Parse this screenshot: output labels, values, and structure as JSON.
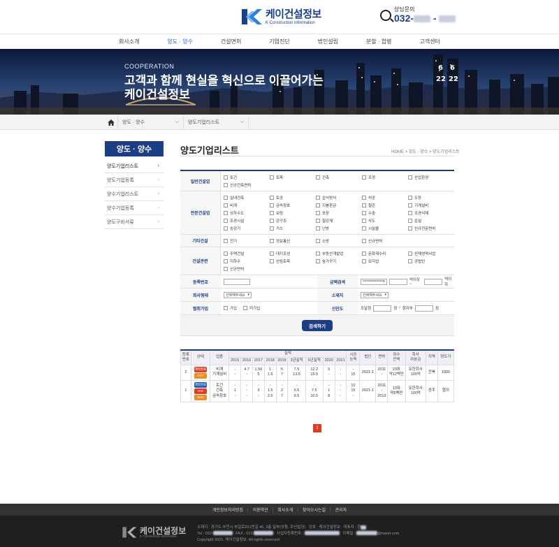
{
  "header": {
    "logo_main": "케이건설정보",
    "logo_sub": "K Construction information",
    "consult_label": "상담문의",
    "consult_prefix": "032-"
  },
  "nav": {
    "items": [
      "회사소개",
      "양도 · 양수",
      "건설면허",
      "기업진단",
      "법인설립",
      "분할 · 합병",
      "고객센터"
    ],
    "active_index": 1
  },
  "banner": {
    "tag": "COOPERATION",
    "title_line1": "고객과 함께 현실을 혁신으로 이끌어가는",
    "title_line2": "케이건설정보"
  },
  "breadcrumb": {
    "select1": "양도 · 양수",
    "select2": "양도기업리스트"
  },
  "sidebar": {
    "title": "양도 · 양수",
    "items": [
      "양도기업리스트",
      "양도기업등록",
      "양수기업리스트",
      "양수기업등록",
      "양도구비서류"
    ],
    "active_index": 0
  },
  "content": {
    "title": "양도기업리스트",
    "location": "HOME > 양도 · 양수 > 양도기업리스트"
  },
  "form": {
    "rows": [
      {
        "head": "일반건설업",
        "items": [
          "토건",
          "토목",
          "건축",
          "조경",
          "산업환경",
          "신규건축면허"
        ]
      },
      {
        "head": "전문건설업",
        "items": [
          "실내건축",
          "토공",
          "습식방식",
          "석공",
          "도장",
          "비계",
          "금속창호",
          "지붕판금",
          "철콘",
          "기계설비",
          "상하수도",
          "보링",
          "포장",
          "수중",
          "조경식재",
          "조경시설",
          "강구조",
          "철강재",
          "삭도",
          "준설",
          "승강기",
          "가스",
          "난방",
          "시설물",
          "신규전문면허"
        ]
      },
      {
        "head": "기타건설",
        "items": [
          "전기",
          "정보통신",
          "소방",
          "신규면허"
        ]
      },
      {
        "head": "건설관련",
        "items": [
          "주택건설",
          "대지조성",
          "부동산개발업",
          "문화재수리",
          "산재영역사업",
          "지하수",
          "산림토목",
          "숲가꾸기",
          "묘지업",
          "공법인",
          "신규면허"
        ]
      }
    ],
    "reg_no_label": "등록번호",
    "amount_label": "금액검색",
    "amount_select": "==========",
    "amount_from": "억이상 ~",
    "amount_to": "억이하",
    "company_type_label": "회사형태",
    "company_type_select": "선택해주세요",
    "location_label": "소재지",
    "location_select": "선택해주세요",
    "assoc_label": "협회가입",
    "assoc_yes": "가입",
    "assoc_no": "미가입",
    "credit_label": "신인도",
    "credit_add_label": "조달청",
    "credit_unit": "점",
    "credit_sep": "/",
    "credit_sub_label": "항자부",
    "search_button": "검색하기"
  },
  "table": {
    "headers": [
      "등록\n번호",
      "상태",
      "업종",
      "실적",
      "시공\n능력",
      "법인",
      "면허",
      "좌수\n잔액",
      "회사\n자본금",
      "지역",
      "양도가"
    ],
    "years": [
      "2015",
      "2016",
      "2017",
      "2018",
      "2019",
      "3년실적",
      "5년실적",
      "2020",
      "2021"
    ],
    "rows": [
      {
        "no": "2",
        "badges": [
          {
            "text": "계약완료",
            "color": "red"
          },
          {
            "text": "HOT",
            "color": "orange"
          }
        ],
        "types": [
          "비계",
          "기계설비"
        ],
        "vals": [
          [
            "-",
            "-"
          ],
          [
            "4.7",
            "-"
          ],
          [
            "1.50",
            "5"
          ],
          [
            "1",
            "1.5"
          ],
          [
            "5",
            "7"
          ],
          [
            "7.5",
            "13.5"
          ],
          [
            "12.2",
            "15.5"
          ],
          [
            "6",
            "-"
          ],
          [
            "-",
            "-"
          ]
        ],
        "capacity": [
          "-",
          "15"
        ],
        "corp": "2021-1",
        "license": [
          "2011",
          "-"
        ],
        "balance": [
          "23좌",
          "약12백만"
        ],
        "capital": [
          "유한회사",
          "100억"
        ],
        "region": "전북",
        "price": "1000"
      },
      {
        "no": "1",
        "badges": [
          {
            "text": "계약완료",
            "color": "blue"
          },
          {
            "text": "new",
            "color": "red"
          },
          {
            "text": "Best",
            "color": "orange"
          }
        ],
        "types": [
          "토건",
          "건축",
          "금속창호"
        ],
        "vals": [
          [
            "-",
            "1",
            "-"
          ],
          [
            "-",
            "-",
            "-"
          ],
          [
            "-",
            "3",
            "-"
          ],
          [
            "-",
            "1.5",
            "2.5"
          ],
          [
            "-",
            "2",
            "7"
          ],
          [
            "-",
            "6.5",
            "9.5"
          ],
          [
            "-",
            "7.5",
            "10.5"
          ],
          [
            "-",
            "1",
            "8"
          ],
          [
            "-",
            "-",
            "-"
          ]
        ],
        "capacity": [
          "10",
          "15",
          "-"
        ],
        "corp": "2021-1",
        "license": [
          "2011",
          "-",
          "2013"
        ],
        "balance": [
          "13좌",
          "약5백만"
        ],
        "capital": [
          "유한회사",
          "100억"
        ],
        "region": "광주",
        "price": "협의"
      }
    ],
    "page": "1"
  },
  "footer": {
    "nav": [
      "개인정보처리방침",
      "이용약관",
      "회사소개",
      "찾아오시는길",
      "관리자"
    ],
    "logo_main": "케이건설정보",
    "logo_sub": "K Construction information",
    "line1_address": "소재지 : 경기도 부천시 부일로221번길 46, 2층 일부(상동, 우신빌딩)",
    "line1_company": "상호 : 케이건설정보",
    "line1_ceo": "대표자 : 한",
    "line2_tel": "Tel : 032-",
    "line2_fax": "FAX : 032-",
    "line2_reg": "사업자등록번호 :",
    "line2_email": "이메일 :",
    "line2_email_domain": "@naver.com",
    "copyright": "Copyright 2021. 케이건설정보.  All rights reserved."
  },
  "colors": {
    "primary": "#1d3d85",
    "accent_red": "#e23b25",
    "accent_orange": "#f08a1c",
    "nav_active": "#2a6cc4"
  }
}
